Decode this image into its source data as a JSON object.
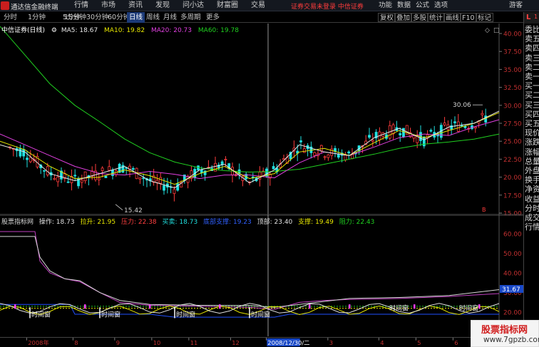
{
  "app": {
    "title": "通达信金融终端",
    "menu": [
      "行情",
      "市场",
      "资讯",
      "发现",
      "问小达",
      "财富圈",
      "交易"
    ],
    "login_status": "证券交易未登录 中信证券",
    "right_menu": [
      "功能",
      "数据",
      "公式",
      "选项"
    ],
    "guest": "游客"
  },
  "periods": [
    "分时",
    "1分钟",
    "5分钟",
    "15分钟",
    "30分钟",
    "60分钟",
    "日线",
    "周线",
    "月线",
    "多周期",
    "更多"
  ],
  "active_period": "日线",
  "toolbar": [
    "复权",
    "叠加",
    "多股",
    "统计",
    "画线",
    "F10",
    "标记"
  ],
  "main_legend": {
    "stock": "中信证券(日线)",
    "ma5": "MA5: 18.67",
    "ma10": "MA10: 19.82",
    "ma20": "MA20: 20.73",
    "ma60": "MA60: 19.78"
  },
  "colors": {
    "ma5": "#e8e8e8",
    "ma10": "#e6e600",
    "ma20": "#e040e0",
    "ma60": "#20d020",
    "up": "#ff3c3c",
    "down": "#20e0e0",
    "accent": "#ff3c3c"
  },
  "price_axis": [
    "40.00",
    "37.50",
    "35.00",
    "32.50",
    "30.00",
    "27.50",
    "25.00",
    "22.50",
    "20.00",
    "17.50",
    "15.00"
  ],
  "annotations": {
    "low": "15.42",
    "high": "30.06"
  },
  "indicator_legend": {
    "name": "股票指标网",
    "op": "操作: 18.73",
    "lashen": "拉升: 21.95",
    "pressure": "压力: 22.38",
    "buy": "买卖: 18.73",
    "support_line": "底部支撑: 19.23",
    "top": "顶部: 23.40",
    "support": "支撑: 19.49",
    "resistance": "阻力: 22.43"
  },
  "indicator_axis": [
    "60.00",
    "50.00",
    "40.00",
    "30.00",
    "20.00"
  ],
  "indicator_label": "31.67",
  "signal_text": "时间窗",
  "date_axis": [
    "2008年",
    "8",
    "9",
    "10",
    "11",
    "12",
    "2008/12/30/二",
    "3",
    "4",
    "5",
    "6"
  ],
  "right_panel": {
    "head_l": "L",
    "head_r": "1",
    "items": [
      "委比",
      "卖五",
      "卖四",
      "卖三",
      "卖二",
      "卖一",
      "买一",
      "买二",
      "买三",
      "买四",
      "买五",
      "现价",
      "涨跌",
      "涨幅",
      "总量",
      "外盘",
      "换手",
      "净资",
      "收益",
      "分时",
      "成交",
      "行情"
    ]
  },
  "watermark": {
    "line1": "股票指标网",
    "line2": "www.7gpzb.com"
  },
  "chart_data": {
    "type": "candlestick",
    "y_range": [
      15,
      40
    ],
    "x_range": [
      0,
      100
    ],
    "ma60": [
      [
        0,
        41
      ],
      [
        5,
        37
      ],
      [
        10,
        33
      ],
      [
        15,
        30
      ],
      [
        20,
        27.7
      ],
      [
        25,
        25.3
      ],
      [
        30,
        23.4
      ],
      [
        35,
        22.1
      ],
      [
        40,
        21.3
      ],
      [
        45,
        20.9
      ],
      [
        50,
        20.7
      ],
      [
        55,
        20.8
      ],
      [
        60,
        21.1
      ],
      [
        65,
        21.8
      ],
      [
        70,
        22.5
      ],
      [
        75,
        23.2
      ],
      [
        80,
        24
      ],
      [
        85,
        24.6
      ],
      [
        90,
        24.9
      ],
      [
        95,
        25.3
      ],
      [
        100,
        26
      ]
    ],
    "ma20": [
      [
        0,
        26
      ],
      [
        5,
        24.5
      ],
      [
        10,
        23
      ],
      [
        15,
        21.5
      ],
      [
        20,
        20.5
      ],
      [
        25,
        20.3
      ],
      [
        30,
        20.8
      ],
      [
        35,
        20.4
      ],
      [
        40,
        19.8
      ],
      [
        45,
        20.3
      ],
      [
        50,
        20.3
      ],
      [
        55,
        19.9
      ],
      [
        60,
        22
      ],
      [
        65,
        23.5
      ],
      [
        70,
        23
      ],
      [
        75,
        24.2
      ],
      [
        80,
        25.5
      ],
      [
        85,
        26
      ],
      [
        90,
        25.8
      ],
      [
        95,
        27
      ],
      [
        100,
        28
      ]
    ],
    "ma10": [
      [
        0,
        25
      ],
      [
        5,
        23.8
      ],
      [
        10,
        21.5
      ],
      [
        15,
        19.8
      ],
      [
        20,
        20
      ],
      [
        25,
        21
      ],
      [
        30,
        20.2
      ],
      [
        35,
        19
      ],
      [
        40,
        20.5
      ],
      [
        45,
        21.5
      ],
      [
        50,
        19.8
      ],
      [
        55,
        20.5
      ],
      [
        60,
        23.5
      ],
      [
        65,
        24
      ],
      [
        70,
        23
      ],
      [
        75,
        24.8
      ],
      [
        80,
        26.5
      ],
      [
        85,
        25.5
      ],
      [
        90,
        26.5
      ],
      [
        95,
        27.5
      ],
      [
        100,
        29
      ]
    ],
    "ma5": [
      [
        0,
        24.5
      ],
      [
        5,
        23.5
      ],
      [
        10,
        20.5
      ],
      [
        15,
        19.5
      ],
      [
        20,
        20.5
      ],
      [
        25,
        21.5
      ],
      [
        30,
        19.5
      ],
      [
        35,
        18.5
      ],
      [
        40,
        21
      ],
      [
        45,
        21.8
      ],
      [
        50,
        19.2
      ],
      [
        55,
        21
      ],
      [
        60,
        24.5
      ],
      [
        65,
        23.5
      ],
      [
        70,
        23
      ],
      [
        75,
        25.5
      ],
      [
        80,
        26.8
      ],
      [
        85,
        25.2
      ],
      [
        90,
        27
      ],
      [
        95,
        27.5
      ],
      [
        100,
        29.2
      ]
    ],
    "indicator_y_range": [
      15,
      65
    ],
    "ind_white": [
      [
        0,
        58.5
      ],
      [
        7,
        58.5
      ],
      [
        8,
        48
      ],
      [
        10,
        41
      ],
      [
        13,
        37
      ],
      [
        16,
        36
      ],
      [
        20,
        30
      ],
      [
        24,
        26
      ],
      [
        30,
        24
      ],
      [
        40,
        23.5
      ],
      [
        50,
        23.4
      ],
      [
        55,
        22.5
      ],
      [
        60,
        24
      ],
      [
        65,
        25.5
      ],
      [
        70,
        27
      ],
      [
        80,
        27.5
      ],
      [
        90,
        28.5
      ],
      [
        100,
        31.5
      ]
    ],
    "ind_magenta": [
      [
        0,
        61
      ],
      [
        7,
        61
      ],
      [
        8,
        46
      ],
      [
        10,
        40
      ],
      [
        13,
        37
      ],
      [
        16,
        35.5
      ],
      [
        20,
        30
      ],
      [
        24,
        25
      ],
      [
        30,
        23.5
      ],
      [
        40,
        23
      ],
      [
        50,
        22.5
      ],
      [
        55,
        21.5
      ],
      [
        60,
        25
      ],
      [
        65,
        26
      ],
      [
        70,
        26.5
      ],
      [
        80,
        27
      ],
      [
        90,
        28
      ],
      [
        100,
        29.5
      ]
    ]
  }
}
